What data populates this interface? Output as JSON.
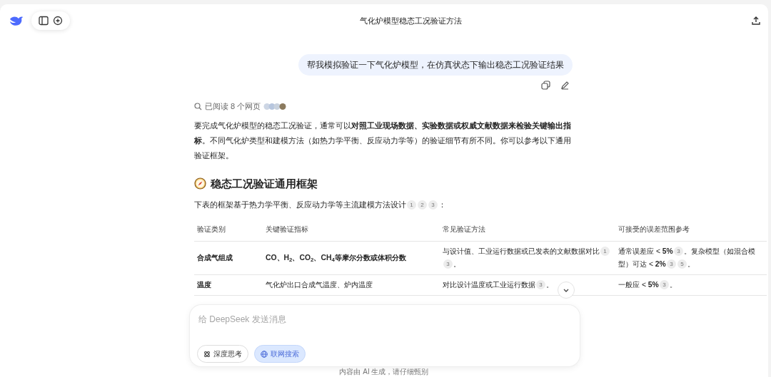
{
  "header": {
    "title": "气化炉模型稳态工况验证方法"
  },
  "user_message": {
    "text": "帮我模拟验证一下气化炉模型，在仿真状态下输出稳态工况验证结果"
  },
  "search_status": {
    "text": "已阅读 8 个网页"
  },
  "answer": {
    "paragraph": "要完成气化炉模型的稳态工况验证，通常可以**对照工业现场数据、实验数据或权威文献数据来检验关键输出指标**。不同气化炉类型和建模方法（如热力学平衡、反应动力学等）的验证细节有所不同。你可以参考以下通用验证框架。",
    "heading": "稳态工况验证通用框架",
    "intro": [
      {
        "t": "下表的框架基于热力学平衡、反应动力学等主流建模方法设计"
      },
      {
        "cite": "1"
      },
      {
        "cite": "2"
      },
      {
        "cite": "3"
      },
      {
        "t": "："
      }
    ],
    "table": {
      "columns": [
        "验证类别",
        "关键验证指标",
        "常见验证方法",
        "可接受的误差范围参考"
      ],
      "rows": [
        [
          {
            "bold": true,
            "parts": [
              {
                "t": "合成气组成"
              }
            ]
          },
          {
            "bold": true,
            "parts": [
              {
                "t": "CO、H$_{2}$、CO$_{2}$、CH$_{4}$等摩尔分数或体积分数"
              }
            ]
          },
          {
            "bold": false,
            "parts": [
              {
                "t": "与设计值、工业运行数据或已发表的文献数据对比"
              },
              {
                "cite": "1"
              },
              {
                "cite": "3"
              },
              {
                "t": "。"
              }
            ]
          },
          {
            "bold": false,
            "parts": [
              {
                "t": "通常误差应 < **5%**"
              },
              {
                "cite": "3"
              },
              {
                "t": "。复杂模型（如混合模型）可达 < **2%**"
              },
              {
                "cite": "3"
              },
              {
                "cite": "5"
              },
              {
                "t": "。"
              }
            ]
          }
        ],
        [
          {
            "bold": true,
            "parts": [
              {
                "t": "温度"
              }
            ]
          },
          {
            "bold": false,
            "parts": [
              {
                "t": "气化炉出口合成气温度、炉内温度"
              }
            ]
          },
          {
            "bold": false,
            "parts": [
              {
                "t": "对比设计温度或工业运行数据"
              },
              {
                "cite": "3"
              },
              {
                "t": "。"
              }
            ]
          },
          {
            "bold": false,
            "parts": [
              {
                "t": "一般应 < **5%**"
              },
              {
                "cite": "3"
              },
              {
                "t": "。"
              }
            ]
          }
        ]
      ]
    }
  },
  "composer": {
    "placeholder": "给 DeepSeek 发送消息",
    "buttons": [
      {
        "kind": "think",
        "label": "深度思考",
        "selected": false
      },
      {
        "kind": "search",
        "label": "联网搜索",
        "selected": true
      }
    ]
  },
  "footer": {
    "text": "内容由 AI 生成，请仔细甄别"
  }
}
